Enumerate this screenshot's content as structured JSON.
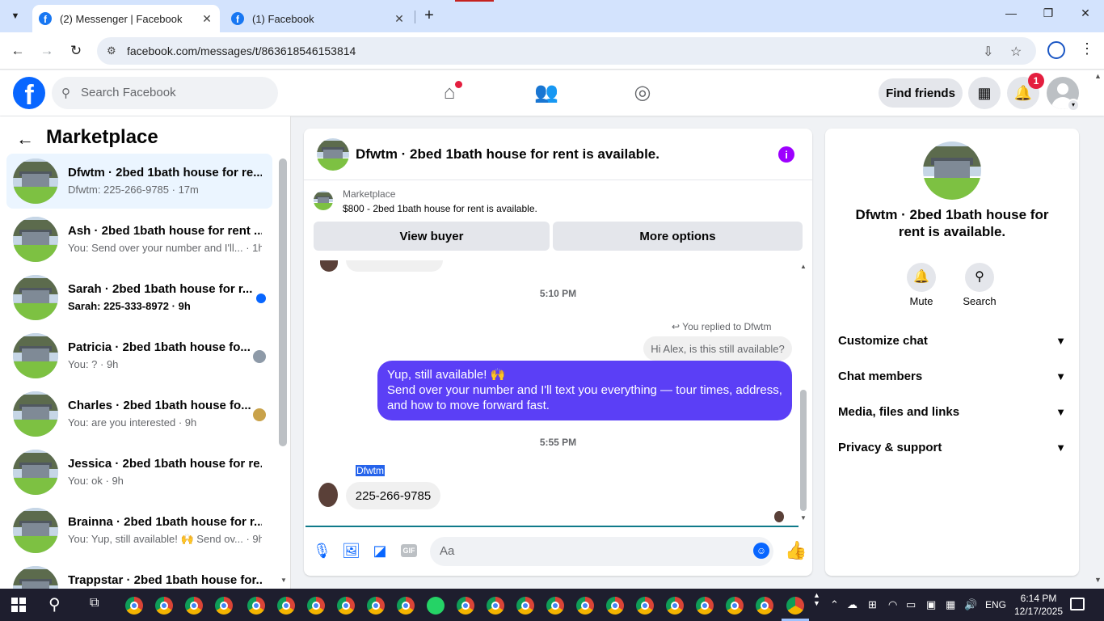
{
  "browser": {
    "tabs": [
      {
        "title": "(2) Messenger | Facebook",
        "active": true
      },
      {
        "title": "(1) Facebook",
        "active": false
      }
    ],
    "url": "facebook.com/messages/t/863618546153814"
  },
  "fb_header": {
    "search_placeholder": "Search Facebook",
    "find_friends_label": "Find friends",
    "notification_count": "1"
  },
  "left_panel": {
    "title": "Marketplace",
    "conversations": [
      {
        "title": "Dfwtm · 2bed 1bath house for re...",
        "subtitle": "Dfwtm: 225-266-9785 · 17m",
        "selected": true
      },
      {
        "title": "Ash · 2bed 1bath house for rent ...",
        "subtitle": "You: Send over your number and I'll... · 1h"
      },
      {
        "title": "Sarah · 2bed 1bath house for r...",
        "subtitle": "Sarah: 225-333-8972 · 9h",
        "unread": true
      },
      {
        "title": "Patricia · 2bed 1bath house fo...",
        "subtitle": "You: ? · 9h"
      },
      {
        "title": "Charles · 2bed 1bath house fo...",
        "subtitle": "You: are you interested · 9h"
      },
      {
        "title": "Jessica · 2bed 1bath house for re...",
        "subtitle": "You: ok · 9h"
      },
      {
        "title": "Brainna · 2bed 1bath house for r...",
        "subtitle": "You: Yup, still available! 🙌 Send ov... · 9h"
      },
      {
        "title": "Trappstar · 2bed 1bath house for...",
        "subtitle": ""
      }
    ]
  },
  "chat": {
    "title": "Dfwtm · 2bed 1bath house for rent is available.",
    "marketplace_label": "Marketplace",
    "listing": "$800 - 2bed 1bath house for rent is available.",
    "view_buyer_label": "View buyer",
    "more_options_label": "More options",
    "time_1": "5:10 PM",
    "replied_note": "You replied to Dfwtm",
    "quoted_text": "Hi Alex, is this still available?",
    "outgoing_line1": "Yup, still available! 🙌",
    "outgoing_line2": "Send over your number and I'll text you everything — tour times, address, and how to move forward fast.",
    "time_2": "5:55 PM",
    "sender_name": "Dfwtm",
    "incoming_text": "225-266-9785",
    "composer_placeholder": "Aa"
  },
  "info_panel": {
    "title": "Dfwtm · 2bed 1bath house for rent is available.",
    "mute_label": "Mute",
    "search_label": "Search",
    "rows": [
      "Customize chat",
      "Chat members",
      "Media, files and links",
      "Privacy & support"
    ]
  },
  "taskbar": {
    "language": "ENG",
    "time": "6:14 PM",
    "date": "12/17/2025"
  },
  "colors": {
    "fb_blue": "#0866ff",
    "message_purple": "#5b3ff6",
    "info_purple": "#9d00ff"
  }
}
